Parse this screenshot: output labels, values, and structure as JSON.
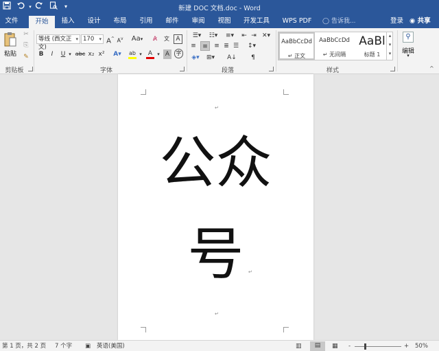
{
  "titlebar": {
    "title": "新建 DOC 文档.doc - Word",
    "save_icon": "save-icon",
    "undo_icon": "undo-icon",
    "redo_icon": "redo-icon",
    "preview_icon": "print-preview-icon",
    "customize_icon": "customize-qat-icon"
  },
  "tabs": [
    {
      "label": "文件"
    },
    {
      "label": "开始"
    },
    {
      "label": "插入"
    },
    {
      "label": "设计"
    },
    {
      "label": "布局"
    },
    {
      "label": "引用"
    },
    {
      "label": "邮件"
    },
    {
      "label": "审阅"
    },
    {
      "label": "视图"
    },
    {
      "label": "开发工具"
    },
    {
      "label": "WPS PDF"
    }
  ],
  "tell_me": "告诉我...",
  "signin": "登录",
  "share": "共享",
  "ribbon": {
    "clipboard": {
      "paste": "粘贴",
      "label": "剪贴板"
    },
    "font": {
      "font_name": "等线 (西文正文)",
      "font_size": "170",
      "grow": "A",
      "shrink": "A",
      "case": "Aa",
      "bold": "B",
      "italic": "I",
      "underline": "U",
      "strike": "abc",
      "sub": "x₂",
      "sup": "x²",
      "label": "字体"
    },
    "paragraph": {
      "label": "段落"
    },
    "styles": {
      "items": [
        {
          "sample": "AaBbCcDd",
          "name": "↵ 正文"
        },
        {
          "sample": "AaBbCcDd",
          "name": "↵ 无间隔"
        },
        {
          "sample": "AaBl",
          "name": "标题 1"
        }
      ],
      "label": "样式"
    },
    "editing": {
      "label": "编辑"
    }
  },
  "document": {
    "line1": "公众",
    "line2": "号"
  },
  "status": {
    "page": "第 1 页，共 2 页",
    "words": "7 个字",
    "language": "英语(美国)",
    "zoom": "50%",
    "zoom_minus": "-",
    "zoom_plus": "+"
  },
  "colors": {
    "accent": "#2b579a",
    "ribbon_bg": "#f3f3f3",
    "highlight": "#ffff00",
    "font_color": "#e00000"
  }
}
